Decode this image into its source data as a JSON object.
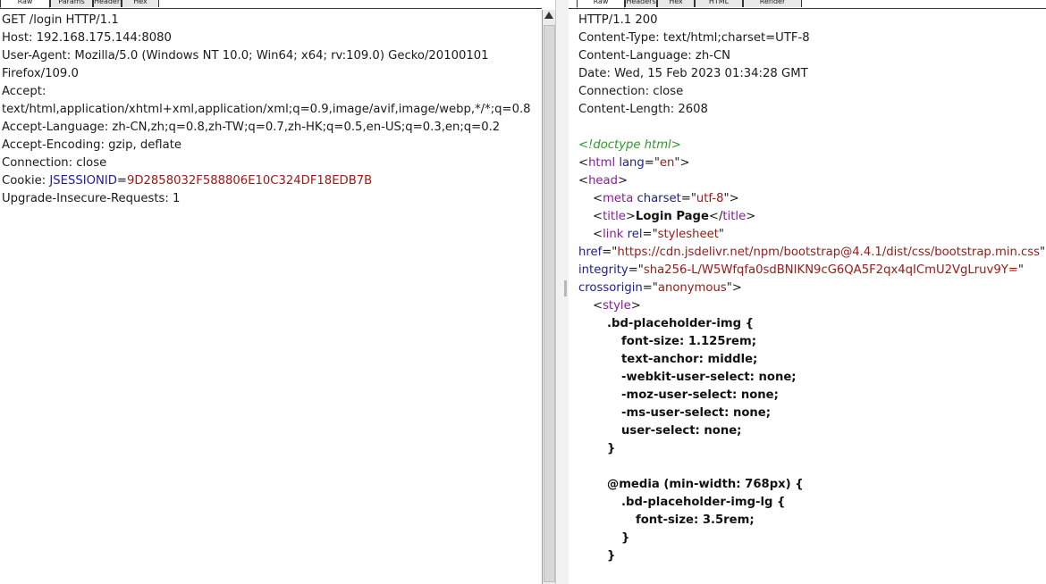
{
  "request": {
    "tabs": [
      "Raw",
      "Params",
      "Headers",
      "Hex"
    ],
    "lines": [
      {
        "indent": 0,
        "tokens": [
          {
            "t": "GET /login HTTP/1.1",
            "c": ""
          }
        ]
      },
      {
        "indent": 0,
        "tokens": [
          {
            "t": "Host: 192.168.175.144:8080",
            "c": ""
          }
        ]
      },
      {
        "indent": 0,
        "tokens": [
          {
            "t": "User-Agent: Mozilla/5.0 (Windows NT 10.0; Win64; x64; rv:109.0) Gecko/20100101",
            "c": ""
          }
        ]
      },
      {
        "indent": 0,
        "tokens": [
          {
            "t": "Firefox/109.0",
            "c": ""
          }
        ]
      },
      {
        "indent": 0,
        "tokens": [
          {
            "t": "Accept:",
            "c": ""
          }
        ]
      },
      {
        "indent": 0,
        "tokens": [
          {
            "t": "text/html,application/xhtml+xml,application/xml;q=0.9,image/avif,image/webp,*/*;q=0.8",
            "c": ""
          }
        ]
      },
      {
        "indent": 0,
        "tokens": [
          {
            "t": "Accept-Language: zh-CN,zh;q=0.8,zh-TW;q=0.7,zh-HK;q=0.5,en-US;q=0.3,en;q=0.2",
            "c": ""
          }
        ]
      },
      {
        "indent": 0,
        "tokens": [
          {
            "t": "Accept-Encoding: gzip, deflate",
            "c": ""
          }
        ]
      },
      {
        "indent": 0,
        "tokens": [
          {
            "t": "Connection: close",
            "c": ""
          }
        ]
      },
      {
        "indent": 0,
        "tokens": [
          {
            "t": "Cookie: ",
            "c": ""
          },
          {
            "t": "JSESSIONID",
            "c": "k-blue"
          },
          {
            "t": "=",
            "c": ""
          },
          {
            "t": "9D2858032F588806E10C324DF18EDB7B",
            "c": "k-red"
          }
        ]
      },
      {
        "indent": 0,
        "tokens": [
          {
            "t": "Upgrade-Insecure-Requests: 1",
            "c": ""
          }
        ]
      }
    ]
  },
  "response": {
    "tabs": [
      "Raw",
      "Headers",
      "Hex",
      "HTML",
      "Render"
    ],
    "lines": [
      {
        "indent": 0,
        "tokens": [
          {
            "t": "HTTP/1.1 200",
            "c": ""
          }
        ]
      },
      {
        "indent": 0,
        "tokens": [
          {
            "t": "Content-Type: text/html;charset=UTF-8",
            "c": ""
          }
        ]
      },
      {
        "indent": 0,
        "tokens": [
          {
            "t": "Content-Language: zh-CN",
            "c": ""
          }
        ]
      },
      {
        "indent": 0,
        "tokens": [
          {
            "t": "Date: Wed, 15 Feb 2023 01:34:28 GMT",
            "c": ""
          }
        ]
      },
      {
        "indent": 0,
        "tokens": [
          {
            "t": "Connection: close",
            "c": ""
          }
        ]
      },
      {
        "indent": 0,
        "tokens": [
          {
            "t": "Content-Length: 2608",
            "c": ""
          }
        ]
      },
      {
        "indent": 0,
        "tokens": [
          {
            "t": "",
            "c": ""
          }
        ]
      },
      {
        "indent": 0,
        "tokens": [
          {
            "t": "<!doctype html>",
            "c": "k-green"
          }
        ]
      },
      {
        "indent": 0,
        "tokens": [
          {
            "t": "<",
            "c": ""
          },
          {
            "t": "html",
            "c": "k-purple"
          },
          {
            "t": " ",
            "c": ""
          },
          {
            "t": "lang",
            "c": "k-blue"
          },
          {
            "t": "=\"",
            "c": ""
          },
          {
            "t": "en",
            "c": "k-red"
          },
          {
            "t": "\">",
            "c": ""
          }
        ]
      },
      {
        "indent": 0,
        "tokens": [
          {
            "t": "<",
            "c": ""
          },
          {
            "t": "head",
            "c": "k-purple"
          },
          {
            "t": ">",
            "c": ""
          }
        ]
      },
      {
        "indent": 1,
        "tokens": [
          {
            "t": "<",
            "c": ""
          },
          {
            "t": "meta",
            "c": "k-purple"
          },
          {
            "t": " ",
            "c": ""
          },
          {
            "t": "charset",
            "c": "k-blue"
          },
          {
            "t": "=\"",
            "c": ""
          },
          {
            "t": "utf-8",
            "c": "k-red"
          },
          {
            "t": "\">",
            "c": ""
          }
        ]
      },
      {
        "indent": 1,
        "tokens": [
          {
            "t": "<",
            "c": ""
          },
          {
            "t": "title",
            "c": "k-purple"
          },
          {
            "t": ">",
            "c": ""
          },
          {
            "t": "Login Page",
            "c": "bold"
          },
          {
            "t": "</",
            "c": ""
          },
          {
            "t": "title",
            "c": "k-purple"
          },
          {
            "t": ">",
            "c": ""
          }
        ]
      },
      {
        "indent": 1,
        "tokens": [
          {
            "t": "<",
            "c": ""
          },
          {
            "t": "link",
            "c": "k-purple"
          },
          {
            "t": " ",
            "c": ""
          },
          {
            "t": "rel",
            "c": "k-blue"
          },
          {
            "t": "=\"",
            "c": ""
          },
          {
            "t": "stylesheet",
            "c": "k-red"
          },
          {
            "t": "\"",
            "c": ""
          }
        ]
      },
      {
        "indent": 0,
        "tokens": [
          {
            "t": "href",
            "c": "k-blue"
          },
          {
            "t": "=\"",
            "c": ""
          },
          {
            "t": "https://cdn.jsdelivr.net/npm/bootstrap@4.4.1/dist/css/bootstrap.min.css",
            "c": "k-red"
          },
          {
            "t": "\"",
            "c": ""
          }
        ]
      },
      {
        "indent": 0,
        "tokens": [
          {
            "t": "integrity",
            "c": "k-blue"
          },
          {
            "t": "=\"",
            "c": ""
          },
          {
            "t": "sha256-L/W5Wfqfa0sdBNIKN9cG6QA5F2qx4qICmU2VgLruv9Y=",
            "c": "k-red"
          },
          {
            "t": "\"",
            "c": ""
          }
        ]
      },
      {
        "indent": 0,
        "tokens": [
          {
            "t": "crossorigin",
            "c": "k-blue"
          },
          {
            "t": "=\"",
            "c": ""
          },
          {
            "t": "anonymous",
            "c": "k-red"
          },
          {
            "t": "\">",
            "c": ""
          }
        ]
      },
      {
        "indent": 1,
        "tokens": [
          {
            "t": "<",
            "c": ""
          },
          {
            "t": "style",
            "c": "k-purple"
          },
          {
            "t": ">",
            "c": ""
          }
        ]
      },
      {
        "indent": 2,
        "tokens": [
          {
            "t": ".bd-placeholder-img {",
            "c": "bold"
          }
        ]
      },
      {
        "indent": 3,
        "tokens": [
          {
            "t": "font-size: 1.125rem;",
            "c": "bold"
          }
        ]
      },
      {
        "indent": 3,
        "tokens": [
          {
            "t": "text-anchor: middle;",
            "c": "bold"
          }
        ]
      },
      {
        "indent": 3,
        "tokens": [
          {
            "t": "-webkit-user-select: none;",
            "c": "bold"
          }
        ]
      },
      {
        "indent": 3,
        "tokens": [
          {
            "t": "-moz-user-select: none;",
            "c": "bold"
          }
        ]
      },
      {
        "indent": 3,
        "tokens": [
          {
            "t": "-ms-user-select: none;",
            "c": "bold"
          }
        ]
      },
      {
        "indent": 3,
        "tokens": [
          {
            "t": "user-select: none;",
            "c": "bold"
          }
        ]
      },
      {
        "indent": 2,
        "tokens": [
          {
            "t": "}",
            "c": "bold"
          }
        ]
      },
      {
        "indent": 0,
        "tokens": [
          {
            "t": "",
            "c": ""
          }
        ]
      },
      {
        "indent": 2,
        "tokens": [
          {
            "t": "@media (min-width: 768px) {",
            "c": "bold"
          }
        ]
      },
      {
        "indent": 3,
        "tokens": [
          {
            "t": ".bd-placeholder-img-lg {",
            "c": "bold"
          }
        ]
      },
      {
        "indent": 4,
        "tokens": [
          {
            "t": "font-size: 3.5rem;",
            "c": "bold"
          }
        ]
      },
      {
        "indent": 3,
        "tokens": [
          {
            "t": "}",
            "c": "bold"
          }
        ]
      },
      {
        "indent": 2,
        "tokens": [
          {
            "t": "}",
            "c": "bold"
          }
        ]
      }
    ]
  }
}
